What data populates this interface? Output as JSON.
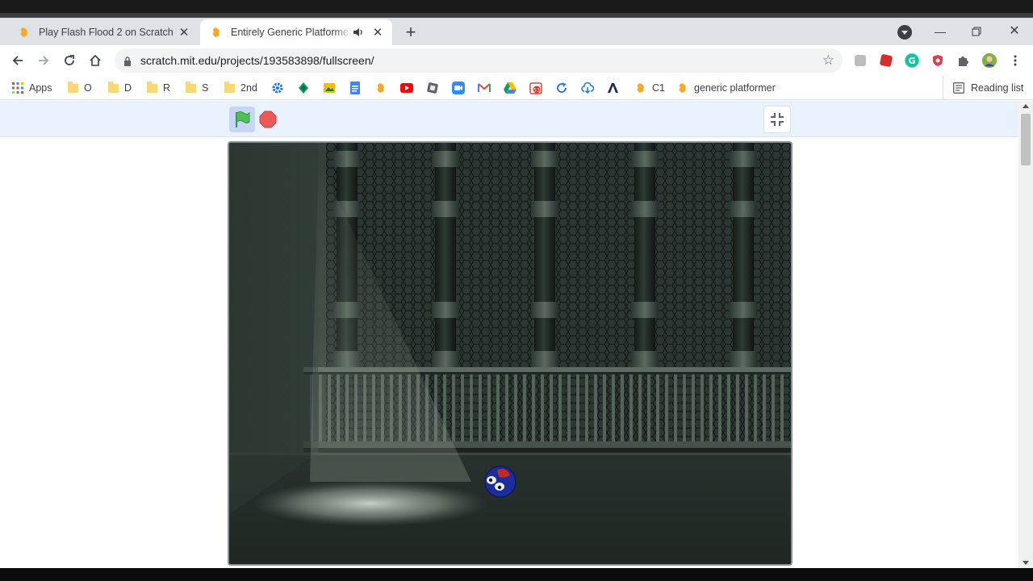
{
  "tabs": [
    {
      "title": "Play Flash Flood 2 on Scratch",
      "active": false
    },
    {
      "title": "Entirely Generic Platformer (A",
      "active": true,
      "audible": true
    }
  ],
  "toolbar": {
    "url": "scratch.mit.edu/projects/193583898/fullscreen/"
  },
  "bookmarks": {
    "apps_label": "Apps",
    "folders": [
      "O",
      "D",
      "R",
      "S",
      "2nd"
    ],
    "c1_label": "C1",
    "generic_label": "generic platformer",
    "reading_list_label": "Reading list"
  },
  "colors": {
    "scratch_bar": "#e9f1fc",
    "flag_green": "#4cbf56",
    "stop_red": "#ec5959",
    "stage_bg": "#2a3430"
  },
  "stage": {
    "pillars": 5,
    "player": "blue-ball-character"
  }
}
